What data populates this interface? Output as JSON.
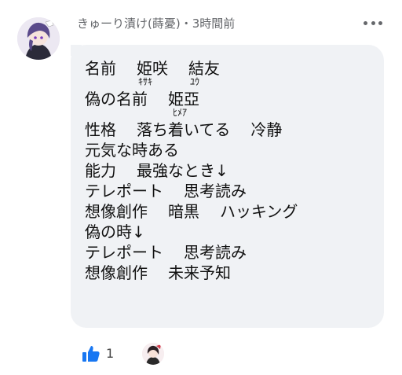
{
  "post": {
    "author": "きゅーり漬け(蒔憂)",
    "separator": "・",
    "time": "3時間前",
    "lines": [
      {
        "a": "名前",
        "b": "姫咲",
        "c": "結友"
      },
      {
        "r1": "ｷｻｷ",
        "r2": "ﾕｳ"
      },
      {
        "a": "偽の名前",
        "b": "姫亞"
      },
      {
        "r1": "ﾋﾒｱ"
      },
      {
        "a": "性格",
        "b": "落ち着いてる",
        "c": "冷静"
      },
      {
        "a": "元気な時ある"
      },
      {
        "a": "能力",
        "b": "最強なとき↓"
      },
      {
        "a": "テレポート",
        "b": "思考読み"
      },
      {
        "a": "想像創作",
        "b": "暗黒",
        "c": "ハッキング"
      },
      {
        "a": "偽の時↓"
      },
      {
        "a": "テレポート",
        "b": "思考読み"
      },
      {
        "a": "想像創作",
        "b": "未来予知"
      }
    ]
  },
  "reactions": {
    "like_count": "1",
    "like_color": "#1877f2"
  },
  "icons": {
    "more": "more-options-icon",
    "like": "thumbs-up-icon"
  }
}
